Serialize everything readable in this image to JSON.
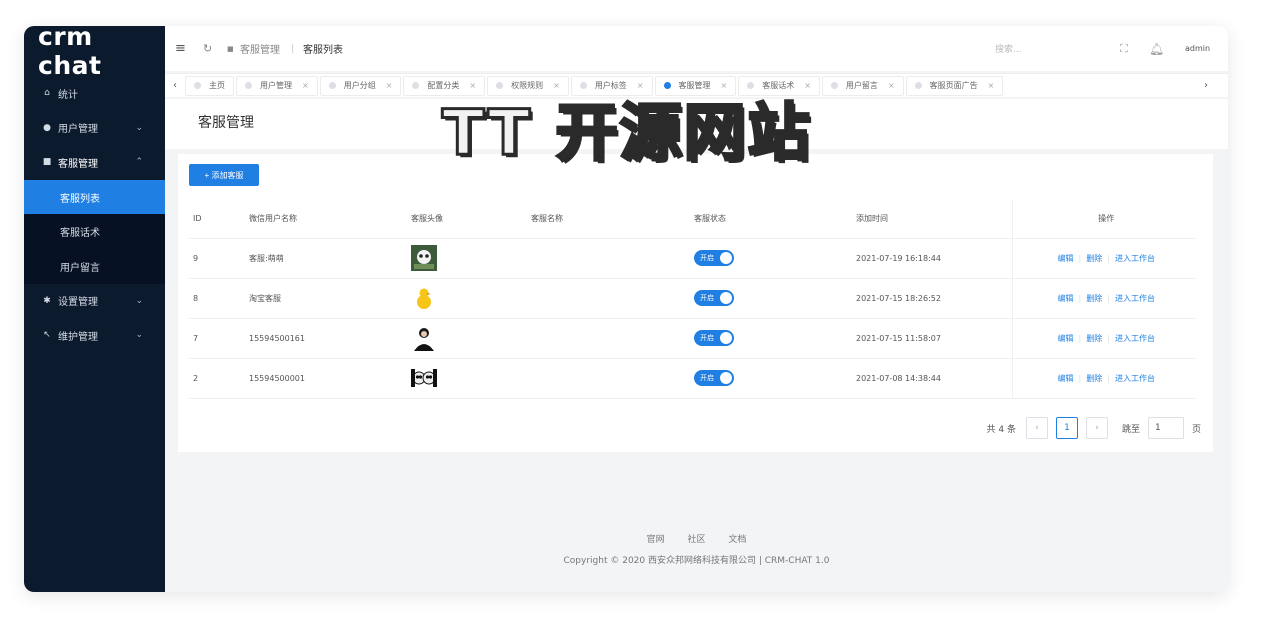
{
  "app": {
    "logo_text": "crm chat"
  },
  "sidebar": {
    "items": [
      {
        "label": "统计",
        "icon": "home-icon"
      },
      {
        "label": "用户管理",
        "icon": "user-icon"
      },
      {
        "label": "客服管理",
        "icon": "chat-icon"
      },
      {
        "label": "设置管理",
        "icon": "gear-icon"
      },
      {
        "label": "维护管理",
        "icon": "wrench-icon"
      }
    ],
    "sub_items": [
      {
        "label": "客服列表"
      },
      {
        "label": "客服话术"
      },
      {
        "label": "用户留言"
      }
    ]
  },
  "topbar": {
    "breadcrumb_parent": "客服管理",
    "breadcrumb_current": "客服列表",
    "search_placeholder": "搜索...",
    "user": "admin"
  },
  "tabs": [
    {
      "label": "主页"
    },
    {
      "label": "用户管理"
    },
    {
      "label": "用户分组"
    },
    {
      "label": "配置分类"
    },
    {
      "label": "权限规则"
    },
    {
      "label": "用户标签"
    },
    {
      "label": "客服管理"
    },
    {
      "label": "客服话术"
    },
    {
      "label": "用户留言"
    },
    {
      "label": "客服页面广告"
    }
  ],
  "page": {
    "title": "客服管理",
    "add_button": "+ 添加客服"
  },
  "table": {
    "headers": {
      "id": "ID",
      "wechat_name": "微信用户名称",
      "avatar": "客服头像",
      "name": "客服名称",
      "status": "客服状态",
      "time": "添加时间",
      "ops": "操作"
    },
    "rows": [
      {
        "id": "9",
        "wechat_name": "客服:萌萌",
        "avatar": "avatar-panda",
        "name": "",
        "status": "开启",
        "time": "2021-07-19 16:18:44"
      },
      {
        "id": "8",
        "wechat_name": "淘宝客服",
        "avatar": "avatar-duck",
        "name": "",
        "status": "开启",
        "time": "2021-07-15 18:26:52"
      },
      {
        "id": "7",
        "wechat_name": "15594500161",
        "avatar": "avatar-person",
        "name": "",
        "status": "开启",
        "time": "2021-07-15 11:58:07"
      },
      {
        "id": "2",
        "wechat_name": "15594500001",
        "avatar": "avatar-pandas",
        "name": "",
        "status": "开启",
        "time": "2021-07-08 14:38:44"
      }
    ],
    "ops": {
      "edit": "编辑",
      "delete": "删除",
      "enter": "进入工作台"
    }
  },
  "pager": {
    "total_label": "共 4 条",
    "current_page": "1",
    "jump_label": "跳至",
    "jump_value": "1",
    "page_unit": "页"
  },
  "footer": {
    "links": [
      "官网",
      "社区",
      "文档"
    ],
    "copyright": "Copyright © 2020 西安众邦网络科技有限公司 | CRM-CHAT 1.0"
  },
  "watermark": "TT 开源网站",
  "colors": {
    "accent": "#1f7fe3",
    "sidebar_bg": "#0c1a2e"
  }
}
